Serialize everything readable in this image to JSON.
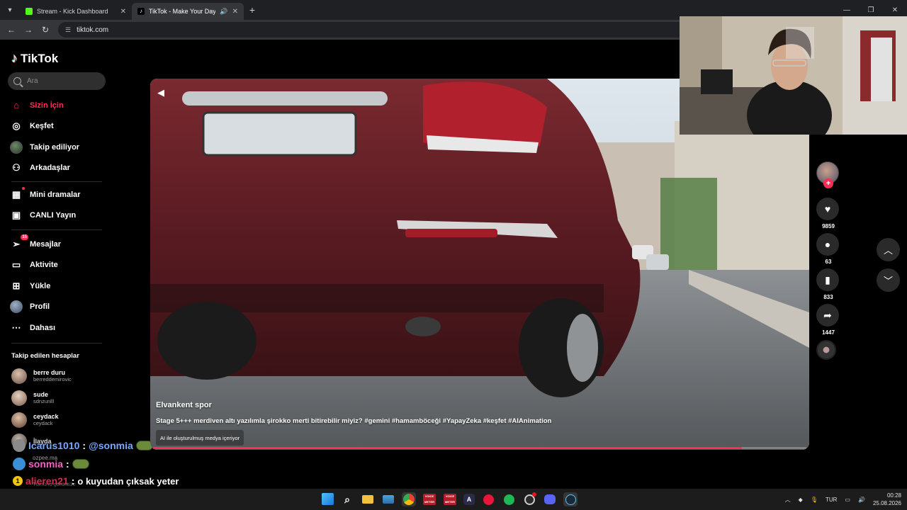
{
  "browser": {
    "tabs": [
      {
        "title": "Stream - Kick Dashboard",
        "favicon_color": "#53fc18",
        "active": false
      },
      {
        "title": "TikTok - Make Your Day",
        "favicon_color": "#ffffff",
        "active": true
      }
    ],
    "url": "tiktok.com"
  },
  "sidebar": {
    "logo_text": "TikTok",
    "search_placeholder": "Ara",
    "nav_primary": [
      {
        "label": "Sizin İçin",
        "icon": "home-icon",
        "active": true
      },
      {
        "label": "Keşfet",
        "icon": "compass-icon"
      },
      {
        "label": "Takip ediliyor",
        "icon": "following-avatar-icon"
      },
      {
        "label": "Arkadaşlar",
        "icon": "friends-icon"
      }
    ],
    "nav_secondary": [
      {
        "label": "Mini dramalar",
        "icon": "film-icon"
      },
      {
        "label": "CANLI Yayın",
        "icon": "live-icon"
      }
    ],
    "nav_tertiary": [
      {
        "label": "Mesajlar",
        "icon": "messages-icon",
        "badge": "15"
      },
      {
        "label": "Aktivite",
        "icon": "activity-icon"
      },
      {
        "label": "Yükle",
        "icon": "upload-icon"
      },
      {
        "label": "Profil",
        "icon": "profile-avatar-icon"
      },
      {
        "label": "Dahası",
        "icon": "more-icon"
      }
    ],
    "followed_title": "Takip edilen hesaplar",
    "followed": [
      {
        "name": "berre duru",
        "handle": "berreddemirovic"
      },
      {
        "name": "sude",
        "handle": "sdnzunlll"
      },
      {
        "name": "ceydack",
        "handle": "ceydack"
      },
      {
        "name": "İlayda",
        "handle": ""
      },
      {
        "name": "ozpee.ma",
        "handle": ""
      },
      {
        "name": "",
        "handle": "Tümünü görüntüle"
      }
    ]
  },
  "chat": [
    {
      "user": "Icarus1010",
      "user_color": "#7aa7ff",
      "message": "@sonmia",
      "msg_color": "#7aa7ff",
      "badge_color": "#8a8a8a",
      "badge_text": "",
      "emote": true
    },
    {
      "user": "sonmia",
      "user_color": "#ff5ec4",
      "message": "",
      "msg_color": "#ffffff",
      "badge_color": "#3a8fd6",
      "badge_text": "",
      "emote": true
    },
    {
      "user": "alieren21",
      "user_color": "#d9294f",
      "message": "o kuyudan çıksak yeter",
      "msg_color": "#ffffff",
      "badge_color": "#f0c419",
      "badge_text": "1",
      "emote": false
    }
  ],
  "video": {
    "author": "Elvankent spor",
    "description": "Stage 5+++ merdiven altı yazılımla şirokko merti bitirebilir miyiz? #gemini #hamamböceği #YapayZeka #keşfet #AIAnimation",
    "ai_label": "AI ile oluşturulmuş medya içeriyor",
    "progress": 0.901,
    "buffered": 0.225
  },
  "actions": {
    "likes": "9859",
    "comments": "63",
    "saves": "833",
    "shares": "1447"
  },
  "taskbar": {
    "apps": [
      "windows-start-icon",
      "search-icon",
      "file-explorer-icon",
      "photos-icon",
      "chrome-icon",
      "voice-meeter-icon",
      "voice-meeter-icon-2",
      "app-icon",
      "youtube-music-icon",
      "spotify-icon",
      "obs-icon",
      "discord-icon",
      "steam-icon"
    ],
    "voicemeeter_label": "VOICE METER",
    "lang": "TUR",
    "time": "00:28",
    "date": "25.08.2026"
  }
}
